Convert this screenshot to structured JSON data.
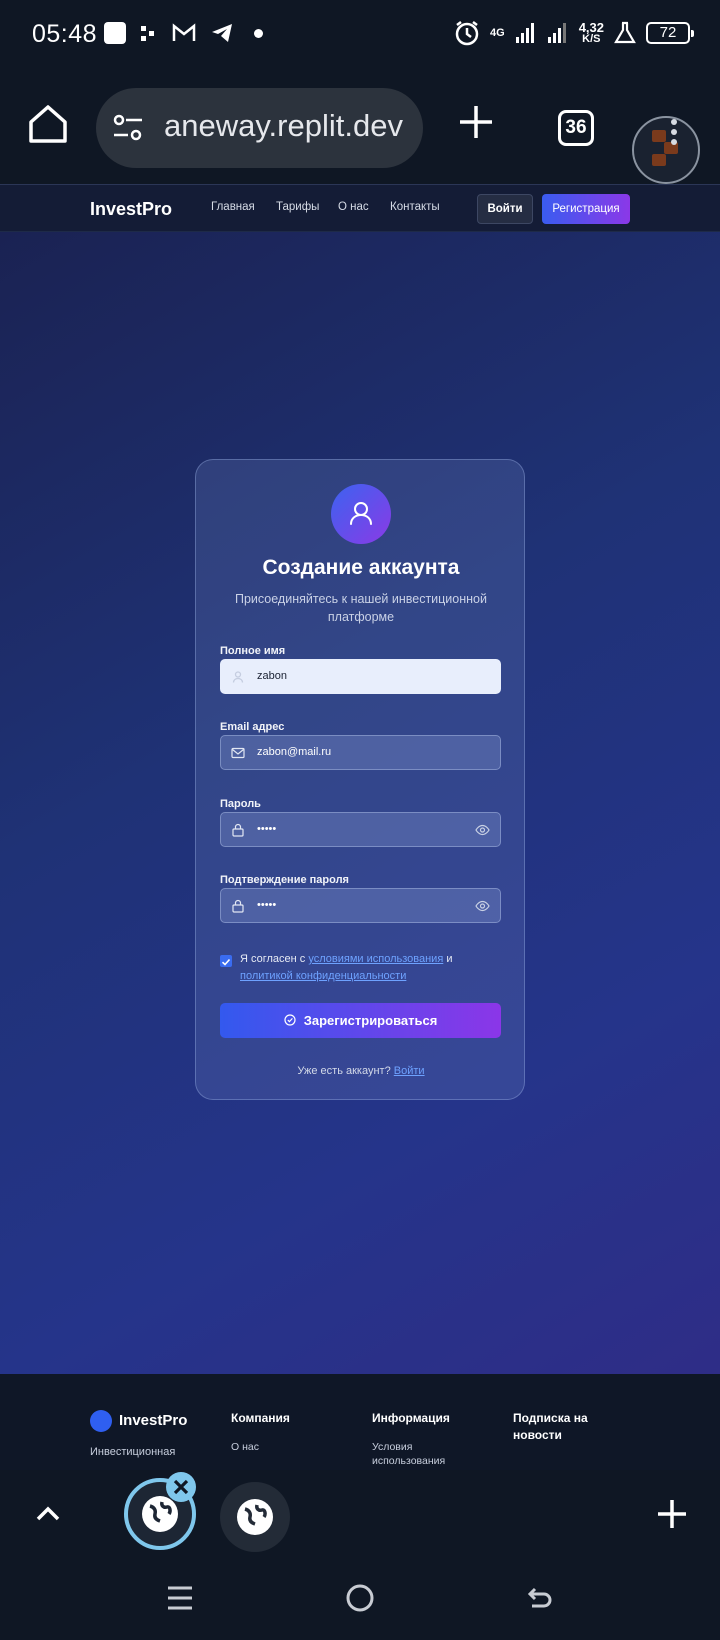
{
  "status_bar": {
    "time": "05:48",
    "network": "4G",
    "speed_value": "4,32",
    "speed_unit": "K/S",
    "battery": "72"
  },
  "browser": {
    "url": "aneway.replit.dev",
    "tab_count": "36"
  },
  "site": {
    "brand": "InvestPro",
    "nav": [
      "Главная",
      "Тарифы",
      "О нас",
      "Контакты"
    ],
    "login_label": "Войти",
    "register_label": "Регистрация"
  },
  "form": {
    "title": "Создание аккаунта",
    "subtitle": "Присоединяйтесь к нашей инвестиционной платформе",
    "fields": [
      {
        "label": "Полное имя",
        "value": "zabon",
        "icon": "user-icon"
      },
      {
        "label": "Email адрес",
        "value": "zabon@mail.ru",
        "icon": "mail-icon"
      },
      {
        "label": "Пароль",
        "value": "•••••",
        "icon": "lock-icon"
      },
      {
        "label": "Подтверждение пароля",
        "value": "•••••",
        "icon": "lock-icon"
      }
    ],
    "agree_prefix": "Я согласен с",
    "agree_terms": "условиями использования",
    "agree_and": "и",
    "agree_privacy": "политикой конфиденциальности",
    "agree_checked": true,
    "submit_label": "Зарегистрироваться",
    "have_account": "Уже есть аккаунт?",
    "login_link": "Войти"
  },
  "footer": {
    "brand": "InvestPro",
    "description": "Инвестиционная",
    "company_heading": "Компания",
    "company_item": "О нас",
    "info_heading": "Информация",
    "info_item_1": "Условия",
    "info_item_2": "использования",
    "subscribe_heading_1": "Подписка на",
    "subscribe_heading_2": "новости"
  },
  "colors": {
    "accent_blue": "#3359ee",
    "accent_purple": "#8b36e8",
    "link": "#6ea2ff",
    "page_bg": "#0f1724"
  }
}
